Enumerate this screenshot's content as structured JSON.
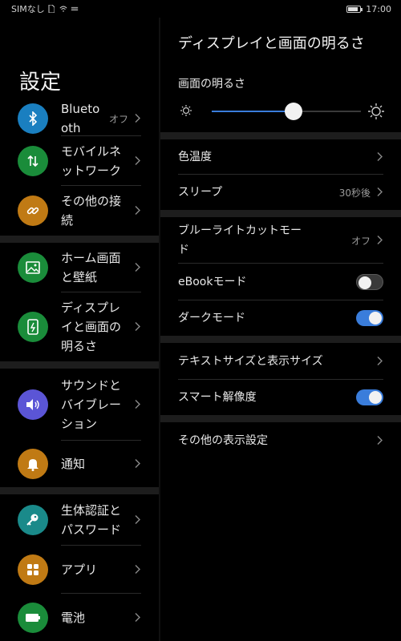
{
  "status_bar": {
    "sim": "SIMなし",
    "time": "17:00"
  },
  "left": {
    "title": "設定",
    "items": [
      {
        "label": "Bluetooth",
        "label_display": "Blueto\noth",
        "value": "オフ",
        "icon": "bluetooth-icon",
        "color": "#1a7fc0"
      },
      {
        "label": "モバイルネットワーク",
        "label_display": "モバイルネ\nットワーク",
        "icon": "mobile-network-icon",
        "color": "#1a8c3a"
      },
      {
        "label": "その他の接続",
        "label_display": "その他の接\n続",
        "icon": "link-icon",
        "color": "#c07a14"
      },
      {
        "label": "ホーム画面と壁紙",
        "label_display": "ホーム画面\nと壁紙",
        "icon": "image-icon",
        "color": "#1a8c3a"
      },
      {
        "label": "ディスプレイと画面の明るさ",
        "label_display": "ディスプレ\nイと画面の\n明るさ",
        "icon": "display-brightness-icon",
        "color": "#1a8c3a"
      },
      {
        "label": "サウンドとバイブレーション",
        "label_display": "サウンドと\nバイブレー\nション",
        "icon": "volume-icon",
        "color": "#5b55d6"
      },
      {
        "label": "通知",
        "label_display": "通知",
        "icon": "bell-icon",
        "color": "#c07a14"
      },
      {
        "label": "生体認証とパスワード",
        "label_display": "生体認証と\nパスワード",
        "icon": "key-icon",
        "color": "#1a8a8a"
      },
      {
        "label": "アプリ",
        "label_display": "アプリ",
        "icon": "apps-icon",
        "color": "#c07a14"
      },
      {
        "label": "電池",
        "label_display": "電池",
        "icon": "battery-icon",
        "color": "#1a8c3a"
      }
    ]
  },
  "right": {
    "title": "ディスプレイと画面の明るさ",
    "brightness_label": "画面の明るさ",
    "brightness_level": 0.55,
    "items": [
      {
        "label": "色温度"
      },
      {
        "label": "スリープ",
        "value": "30秒後"
      },
      {
        "label": "ブルーライトカットモード",
        "label_display": "ブルーライトカットモー\nド",
        "value": "オフ"
      },
      {
        "label": "eBookモード",
        "toggle": false
      },
      {
        "label": "ダークモード",
        "toggle": true
      },
      {
        "label": "テキストサイズと表示サイズ"
      },
      {
        "label": "スマート解像度",
        "toggle": true
      },
      {
        "label": "その他の表示設定"
      }
    ]
  }
}
